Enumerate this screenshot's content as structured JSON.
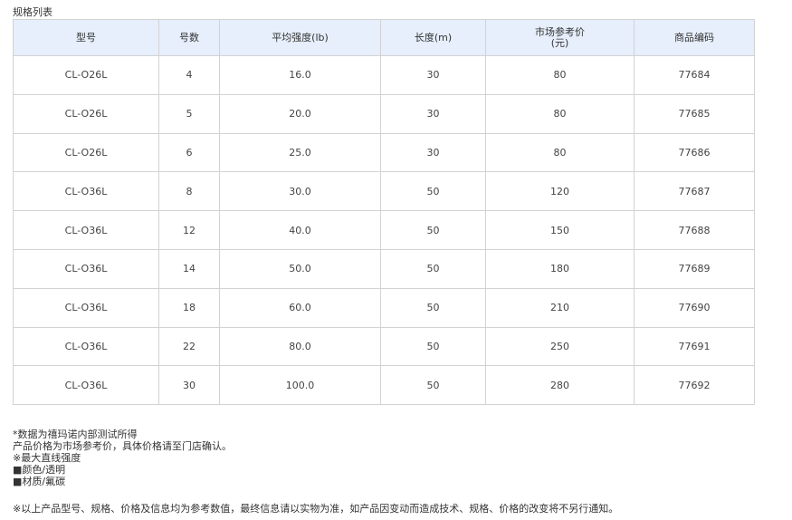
{
  "section_title": "规格列表",
  "table": {
    "headers": [
      "型号",
      "号数",
      "平均强度(lb)",
      "长度(m)",
      "市场参考价\n(元)",
      "商品编码"
    ],
    "rows": [
      [
        "CL-O26L",
        "4",
        "16.0",
        "30",
        "80",
        "77684"
      ],
      [
        "CL-O26L",
        "5",
        "20.0",
        "30",
        "80",
        "77685"
      ],
      [
        "CL-O26L",
        "6",
        "25.0",
        "30",
        "80",
        "77686"
      ],
      [
        "CL-O36L",
        "8",
        "30.0",
        "50",
        "120",
        "77687"
      ],
      [
        "CL-O36L",
        "12",
        "40.0",
        "50",
        "150",
        "77688"
      ],
      [
        "CL-O36L",
        "14",
        "50.0",
        "50",
        "180",
        "77689"
      ],
      [
        "CL-O36L",
        "18",
        "60.0",
        "50",
        "210",
        "77690"
      ],
      [
        "CL-O36L",
        "22",
        "80.0",
        "50",
        "250",
        "77691"
      ],
      [
        "CL-O36L",
        "30",
        "100.0",
        "50",
        "280",
        "77692"
      ]
    ]
  },
  "notes": [
    "*数据为禧玛诺内部测试所得",
    "产品价格为市场参考价，具体价格请至门店确认。",
    "※最大直线强度",
    "■颜色/透明",
    "■材质/氟碳"
  ],
  "disclaimer": "※以上产品型号、规格、价格及信息均为参考数值，最终信息请以实物为准，如产品因变动而造成技术、规格、价格的改变将不另行通知。",
  "colors": {
    "header_bg": "#e6effb",
    "border": "#d2d2d2",
    "text": "#333333"
  }
}
